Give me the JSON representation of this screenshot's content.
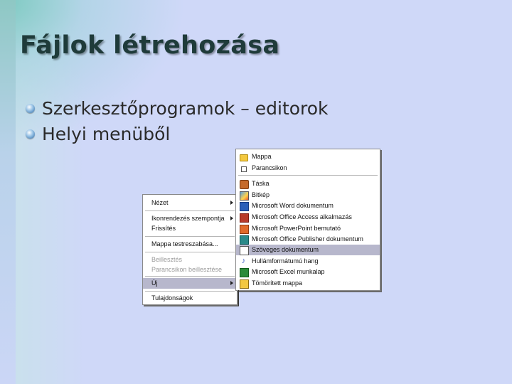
{
  "slide": {
    "title": "Fájlok létrehozása",
    "bullets": [
      "Szerkesztőprogramok – editorok",
      "Helyi menüből"
    ]
  },
  "context_menu": {
    "items": [
      {
        "label": "Nézet",
        "submenu": true,
        "enabled": true
      },
      {
        "label": "Ikonrendezés szempontja",
        "submenu": true,
        "enabled": true
      },
      {
        "label": "Frissítés",
        "submenu": false,
        "enabled": true
      },
      {
        "label": "Mappa testreszabása...",
        "submenu": false,
        "enabled": true
      },
      {
        "label": "Beillesztés",
        "submenu": false,
        "enabled": false
      },
      {
        "label": "Parancsikon beillesztése",
        "submenu": false,
        "enabled": false
      },
      {
        "label": "Új",
        "submenu": true,
        "enabled": true,
        "selected": true
      },
      {
        "label": "Tulajdonságok",
        "submenu": false,
        "enabled": true
      }
    ]
  },
  "new_submenu": {
    "items": [
      {
        "label": "Mappa",
        "icon": "folder-icon"
      },
      {
        "label": "Parancsikon",
        "icon": "shortcut-icon"
      },
      {
        "label": "Táska",
        "icon": "briefcase-icon"
      },
      {
        "label": "Bitkép",
        "icon": "bitmap-icon"
      },
      {
        "label": "Microsoft Word dokumentum",
        "icon": "word-icon"
      },
      {
        "label": "Microsoft Office Access alkalmazás",
        "icon": "access-icon"
      },
      {
        "label": "Microsoft PowerPoint bemutató",
        "icon": "powerpoint-icon"
      },
      {
        "label": "Microsoft Office Publisher dokumentum",
        "icon": "publisher-icon"
      },
      {
        "label": "Szöveges dokumentum",
        "icon": "text-document-icon",
        "selected": true
      },
      {
        "label": "Hullámformátumú hang",
        "icon": "wave-sound-icon"
      },
      {
        "label": "Microsoft Excel munkalap",
        "icon": "excel-icon"
      },
      {
        "label": "Tömörített mappa",
        "icon": "compressed-folder-icon"
      }
    ]
  },
  "colors": {
    "background": "#cfd8f8",
    "title": "#1f3b3a",
    "menu_selection": "#b7b7cc"
  }
}
